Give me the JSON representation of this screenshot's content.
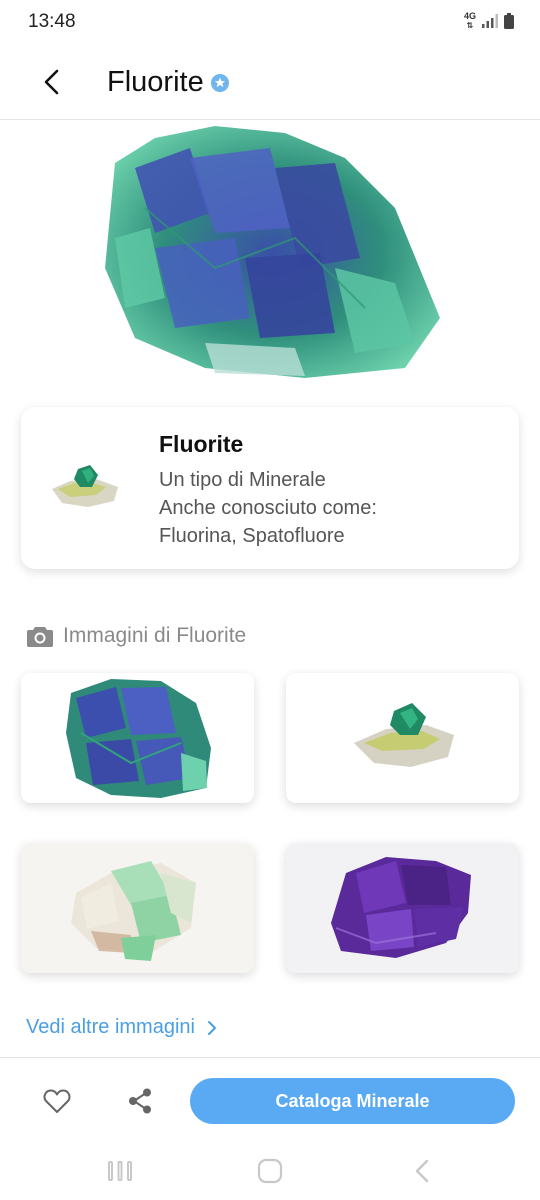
{
  "status_bar": {
    "time": "13:48",
    "network": "4G",
    "icons": [
      "data-arrows-icon",
      "signal-icon",
      "battery-icon"
    ]
  },
  "header": {
    "title": "Fluorite",
    "back_icon": "chevron-left-icon",
    "badge_icon": "verified-star-badge-icon"
  },
  "info_card": {
    "name": "Fluorite",
    "type": "Un tipo di Minerale",
    "aka_label": "Anche conosciuto come:",
    "aka_values": "Fluorina, Spatofluore"
  },
  "images_section": {
    "icon": "camera-icon",
    "title": "Immagini di Fluorite",
    "images": [
      {
        "description": "green-purple fluorite cluster"
      },
      {
        "description": "green fluorite crystal on pale matrix"
      },
      {
        "description": "pale green fluorite with white quartz"
      },
      {
        "description": "purple cubic fluorite"
      }
    ],
    "more_link": "Vedi altre immagini"
  },
  "bottom_bar": {
    "favorite_icon": "heart-icon",
    "share_icon": "share-icon",
    "primary_button": "Cataloga Minerale"
  },
  "system_nav": {
    "icons": [
      "recent-apps-icon",
      "home-icon",
      "back-icon"
    ]
  },
  "colors": {
    "accent": "#5aaaf3",
    "link": "#4a9ee6",
    "badge": "#6fb6ee",
    "muted_text": "#8a8a8a"
  }
}
